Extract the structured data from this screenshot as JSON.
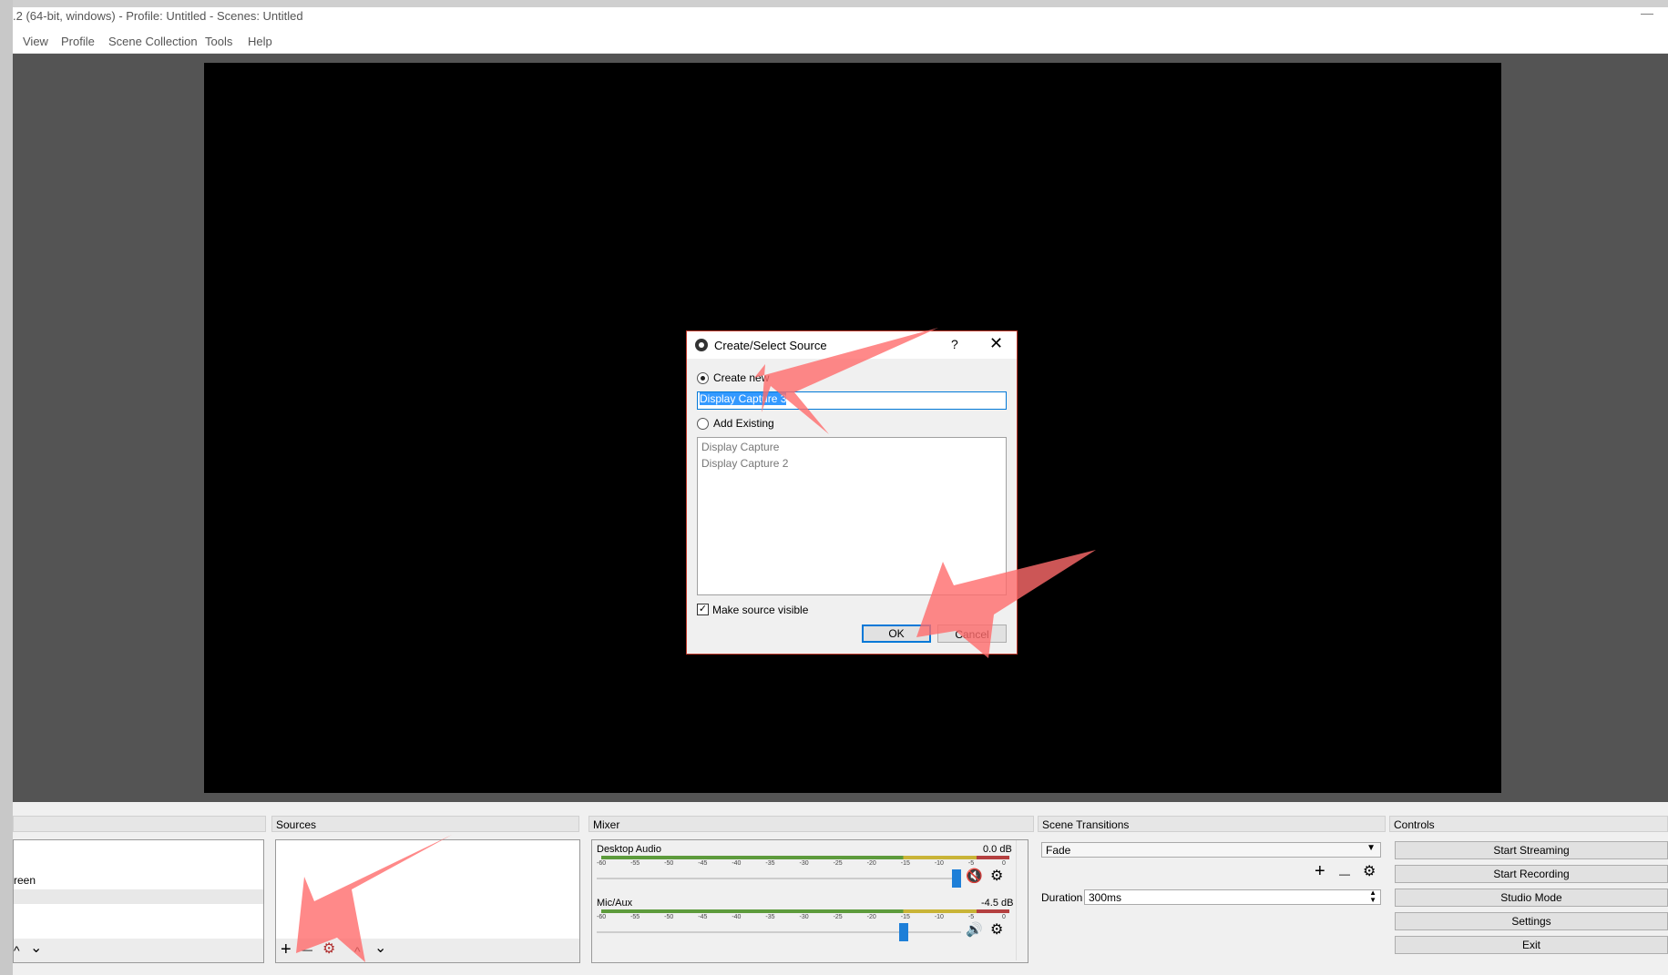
{
  "window": {
    "title": ".2 (64-bit, windows) - Profile: Untitled - Scenes: Untitled",
    "minimize_glyph": "—"
  },
  "menu": {
    "items": [
      "View",
      "Profile",
      "Scene Collection",
      "Tools",
      "Help"
    ]
  },
  "dialog": {
    "title": "Create/Select Source",
    "help": "?",
    "close": "✕",
    "create_new_label": "Create new",
    "name_value": "Display Capture 3",
    "add_existing_label": "Add Existing",
    "existing_sources": [
      "Display Capture",
      "Display Capture 2"
    ],
    "make_visible_label": "Make source visible",
    "make_visible_checked": "✓",
    "ok_label": "OK",
    "cancel_label": "Cancel"
  },
  "scenes": {
    "items": [
      "reen"
    ],
    "up_glyph": "^",
    "down_glyph": "⌄"
  },
  "sources": {
    "header": "Sources",
    "add_glyph": "+",
    "remove_glyph": "—",
    "settings_glyph": "⚙",
    "up_glyph": "^",
    "down_glyph": "⌄"
  },
  "mixer": {
    "header": "Mixer",
    "channels": [
      {
        "name": "Desktop Audio",
        "db": "0.0 dB",
        "muted": true,
        "level": 1.0
      },
      {
        "name": "Mic/Aux",
        "db": "-4.5 dB",
        "muted": false,
        "level": 0.85
      }
    ],
    "ticks": [
      "-60",
      "-55",
      "-50",
      "-45",
      "-40",
      "-35",
      "-30",
      "-25",
      "-20",
      "-15",
      "-10",
      "-5",
      "0"
    ],
    "mute_glyph": "🔇",
    "speaker_glyph": "🔊",
    "gear_glyph": "⚙"
  },
  "transitions": {
    "header": "Scene Transitions",
    "selected": "Fade",
    "add_glyph": "+",
    "remove_glyph": "—",
    "settings_glyph": "⚙",
    "duration_label": "Duration",
    "duration_value": "300ms"
  },
  "controls": {
    "header": "Controls",
    "buttons": [
      "Start Streaming",
      "Start Recording",
      "Studio Mode",
      "Settings",
      "Exit"
    ]
  },
  "colors": {
    "arrow": "#ff6b6b",
    "accent_blue": "#0078d7",
    "mute_red": "#d32f2f"
  }
}
